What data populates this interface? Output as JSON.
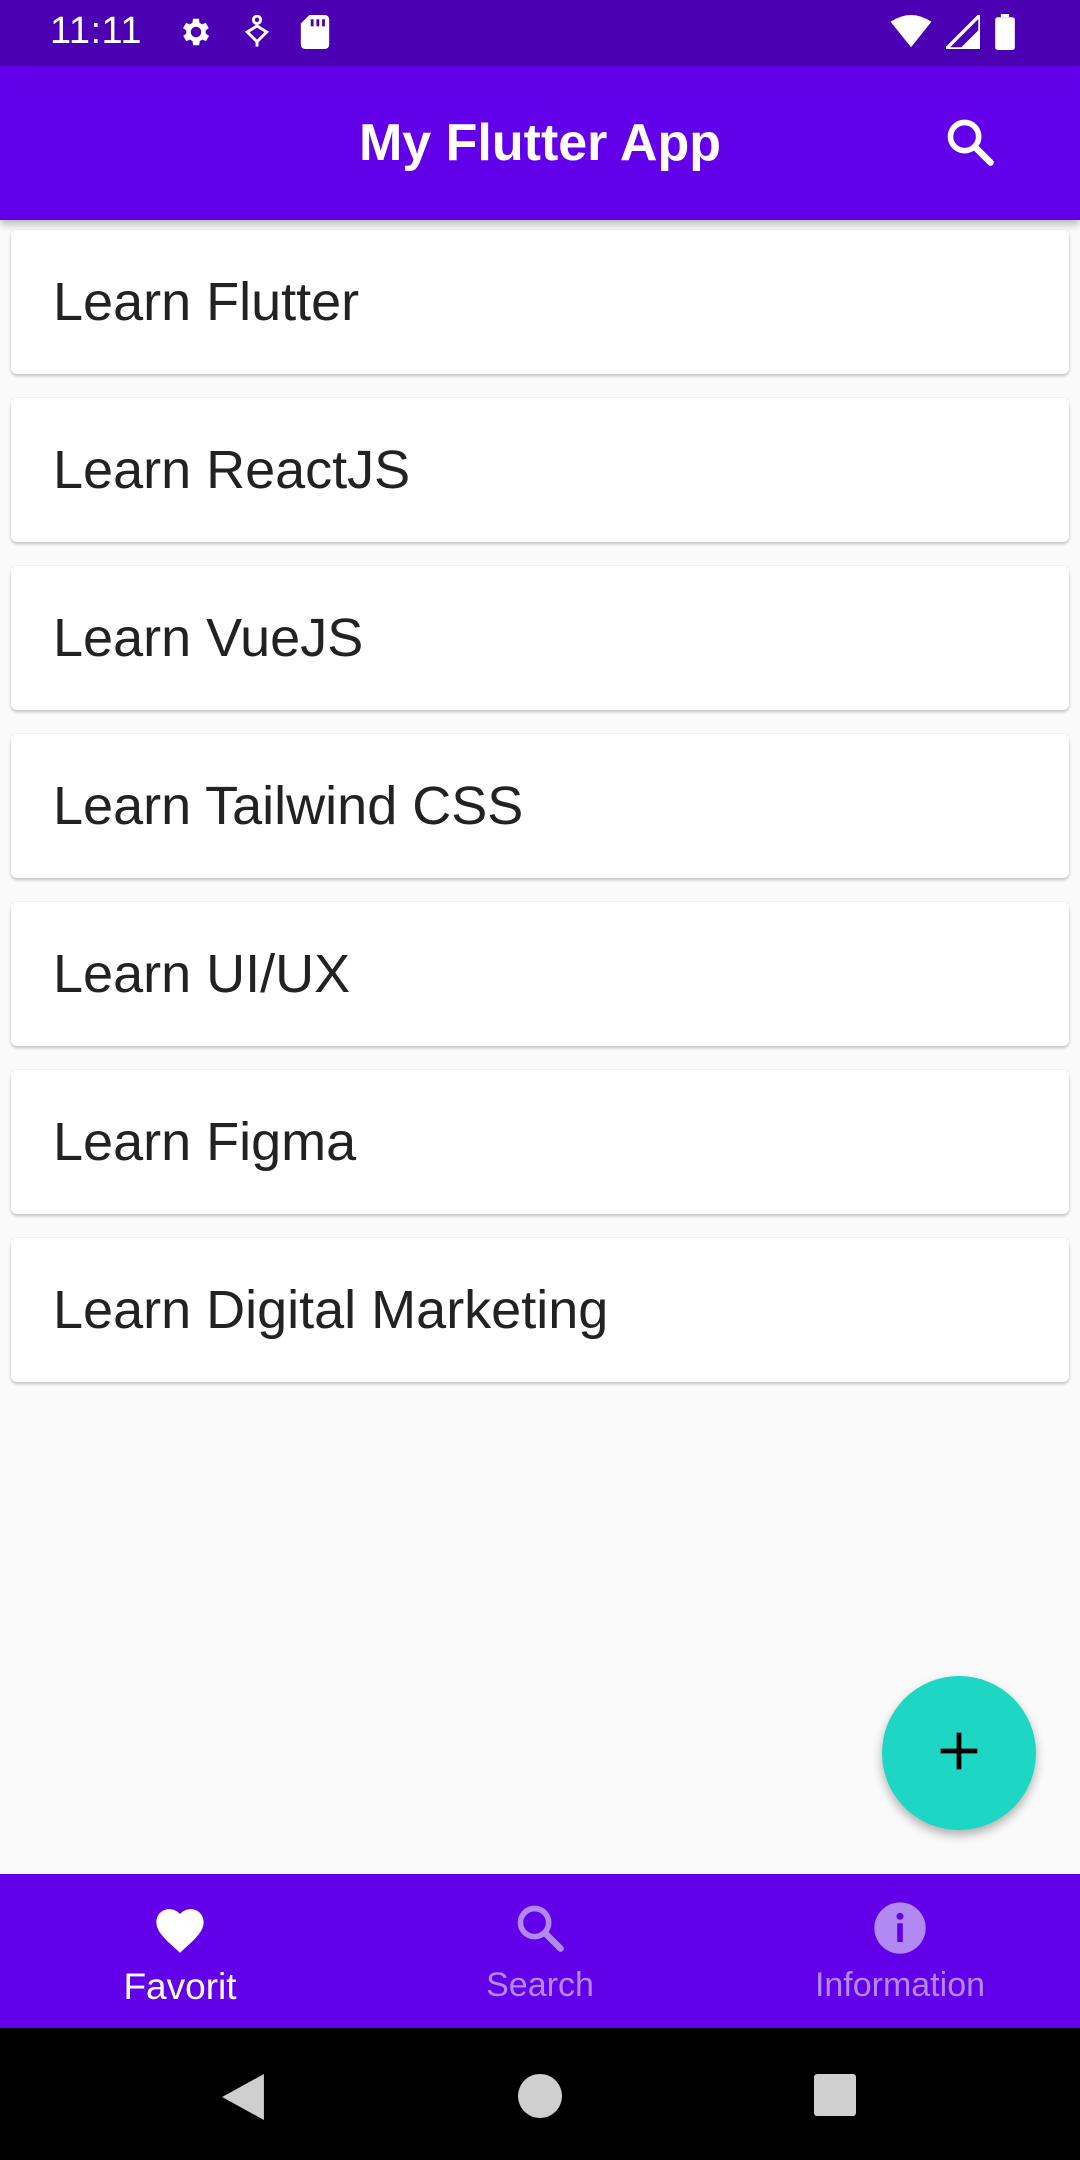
{
  "status_bar": {
    "time": "11:11",
    "icons_left": [
      "gear-icon",
      "accessibility-icon",
      "sd-card-icon"
    ],
    "icons_right": [
      "wifi-icon",
      "signal-icon",
      "battery-icon"
    ]
  },
  "app_bar": {
    "title": "My Flutter App",
    "action_icon": "search-icon"
  },
  "courses": [
    {
      "label": "Learn Flutter"
    },
    {
      "label": "Learn ReactJS"
    },
    {
      "label": "Learn VueJS"
    },
    {
      "label": "Learn Tailwind CSS"
    },
    {
      "label": "Learn UI/UX"
    },
    {
      "label": "Learn Figma"
    },
    {
      "label": "Learn Digital Marketing"
    }
  ],
  "fab": {
    "icon": "plus-icon",
    "color": "#1ed6c4"
  },
  "bottom_nav": {
    "items": [
      {
        "label": "Favorit",
        "icon": "heart-icon",
        "active": true
      },
      {
        "label": "Search",
        "icon": "search-icon",
        "active": false
      },
      {
        "label": "Information",
        "icon": "info-icon",
        "active": false
      }
    ]
  },
  "system_nav": {
    "icons": [
      "back-icon",
      "home-icon",
      "recents-icon"
    ]
  },
  "colors": {
    "primary": "#6200ea",
    "status_bar": "#4b00b4",
    "accent": "#1ed6c4",
    "inactive_nav": "#b288f2"
  }
}
